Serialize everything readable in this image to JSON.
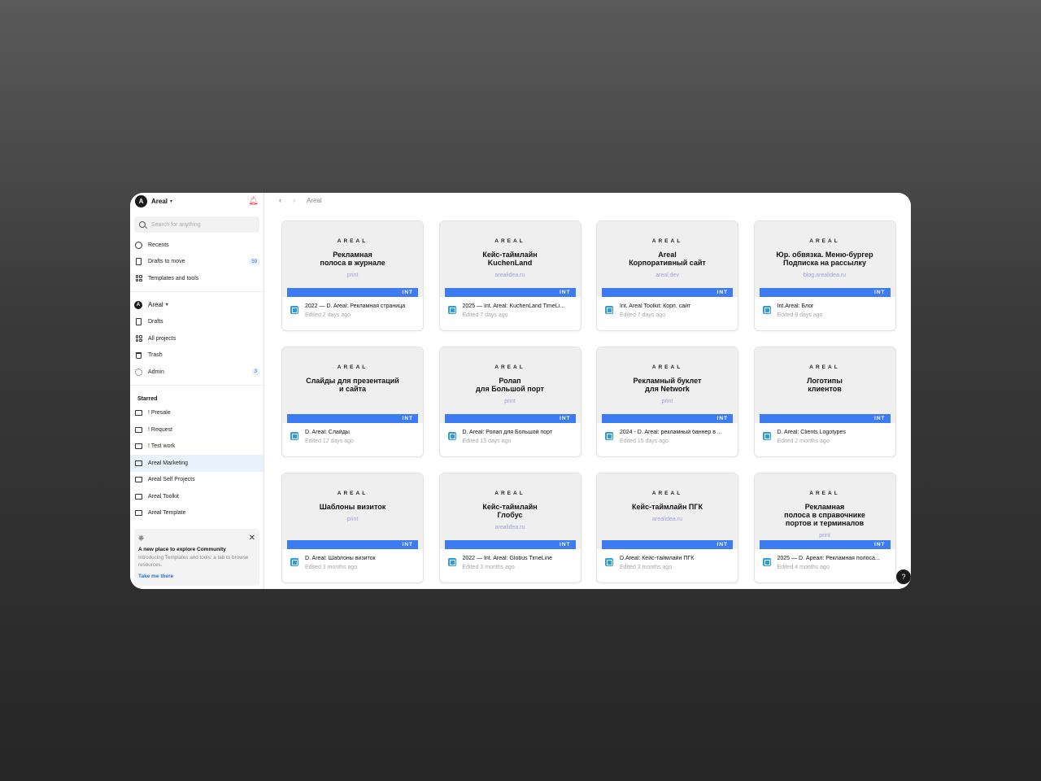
{
  "workspace": {
    "name": "Areal",
    "logo_letter": "A"
  },
  "search": {
    "placeholder": "Search for anything"
  },
  "top_nav": [
    {
      "label": "Recents",
      "icon": "clock-icon"
    },
    {
      "label": "Drafts to move",
      "icon": "document-icon",
      "badge": "59"
    },
    {
      "label": "Templates and tools",
      "icon": "templates-icon"
    }
  ],
  "team": {
    "name": "Areal"
  },
  "team_nav": [
    {
      "label": "Drafts",
      "icon": "document-icon"
    },
    {
      "label": "All projects",
      "icon": "grid-icon"
    },
    {
      "label": "Trash",
      "icon": "trash-icon"
    },
    {
      "label": "Admin",
      "icon": "gear-icon",
      "badge": "3"
    }
  ],
  "starred": {
    "label": "Starred",
    "items": [
      "! Presale",
      "! Request",
      "! Test work",
      "Areal Marketing",
      "Areal Self Projects",
      "Areal Toolkit",
      "Areal Template"
    ]
  },
  "promo": {
    "title": "A new place to explore Community",
    "body": "Introducing Templates and tools: a tab to browse resources.",
    "link": "Take me there"
  },
  "breadcrumb": "Areal",
  "cards": [
    {
      "brand": "AREAL",
      "title": "Рекламная\nполоса в журнале",
      "subtitle": "print",
      "tag": "INT",
      "name": "2022 — D. Areal: Рекламная страница",
      "edited": "Edited 2 days ago"
    },
    {
      "brand": "AREAL",
      "title": "Кейс-таймлайн\nKuchenLand",
      "subtitle": "arealidea.ru",
      "tag": "INT",
      "name": "2025 — Int. Areal: KuchenLand TimeLi...",
      "edited": "Edited 7 days ago"
    },
    {
      "brand": "AREAL",
      "title": "Areal\nКорпоративный сайт",
      "subtitle": "areal.dev",
      "tag": "INT",
      "name": "Int. Areal Toolkit: Корп. сайт",
      "edited": "Edited 7 days ago"
    },
    {
      "brand": "AREAL",
      "title": "Юр. обвязка. Меню-бургер\nПодписка на рассылку",
      "subtitle": "blog.arealidea.ru",
      "tag": "INT",
      "name": "Int.Areal: Блог",
      "edited": "Edited 8 days ago"
    },
    {
      "brand": "AREAL",
      "title": "Слайды для презентаций\nи сайта",
      "subtitle": "",
      "tag": "INT",
      "name": "D. Areal: Слайды",
      "edited": "Edited 12 days ago"
    },
    {
      "brand": "AREAL",
      "title": "Ролап\nдля Большой порт",
      "subtitle": "print",
      "tag": "INT",
      "name": "D. Areal: Ролап для Большой порт",
      "edited": "Edited 13 days ago"
    },
    {
      "brand": "AREAL",
      "title": "Рекламный буклет\nдля Network",
      "subtitle": "print",
      "tag": "INT",
      "name": "2024 - D. Areal: рекламный баннер в ...",
      "edited": "Edited 15 days ago"
    },
    {
      "brand": "AREAL",
      "title": "Логотипы\nклиентов",
      "subtitle": "",
      "tag": "INT",
      "name": "D. Areal: Clients Logotypes",
      "edited": "Edited 2 months ago"
    },
    {
      "brand": "AREAL",
      "title": "Шаблоны визиток",
      "subtitle": "print",
      "tag": "INT",
      "name": "D. Areal: Шаблоны визиток",
      "edited": "Edited 3 months ago"
    },
    {
      "brand": "AREAL",
      "title": "Кейс-таймлайн\nГлобус",
      "subtitle": "arealidea.ru",
      "tag": "INT",
      "name": "2022 — Int. Areal: Globus TimeLine",
      "edited": "Edited 3 months ago"
    },
    {
      "brand": "AREAL",
      "title": "Кейс-таймлайн ПГК",
      "subtitle": "arealidea.ru",
      "tag": "INT",
      "name": "D.Areal: Кейс-таймлайн ПГК",
      "edited": "Edited 3 months ago"
    },
    {
      "brand": "AREAL",
      "title": "Рекламная\nполоса в справочнике\nпортов и терминалов",
      "subtitle": "print",
      "tag": "INT",
      "name": "2025 — D. Ареал: Рекламная полоса...",
      "edited": "Edited 4 months ago"
    }
  ],
  "help_label": "?",
  "colors": {
    "accent": "#3d7bf2",
    "active_row": "#e8f2fd",
    "bell": "#e5484d"
  }
}
